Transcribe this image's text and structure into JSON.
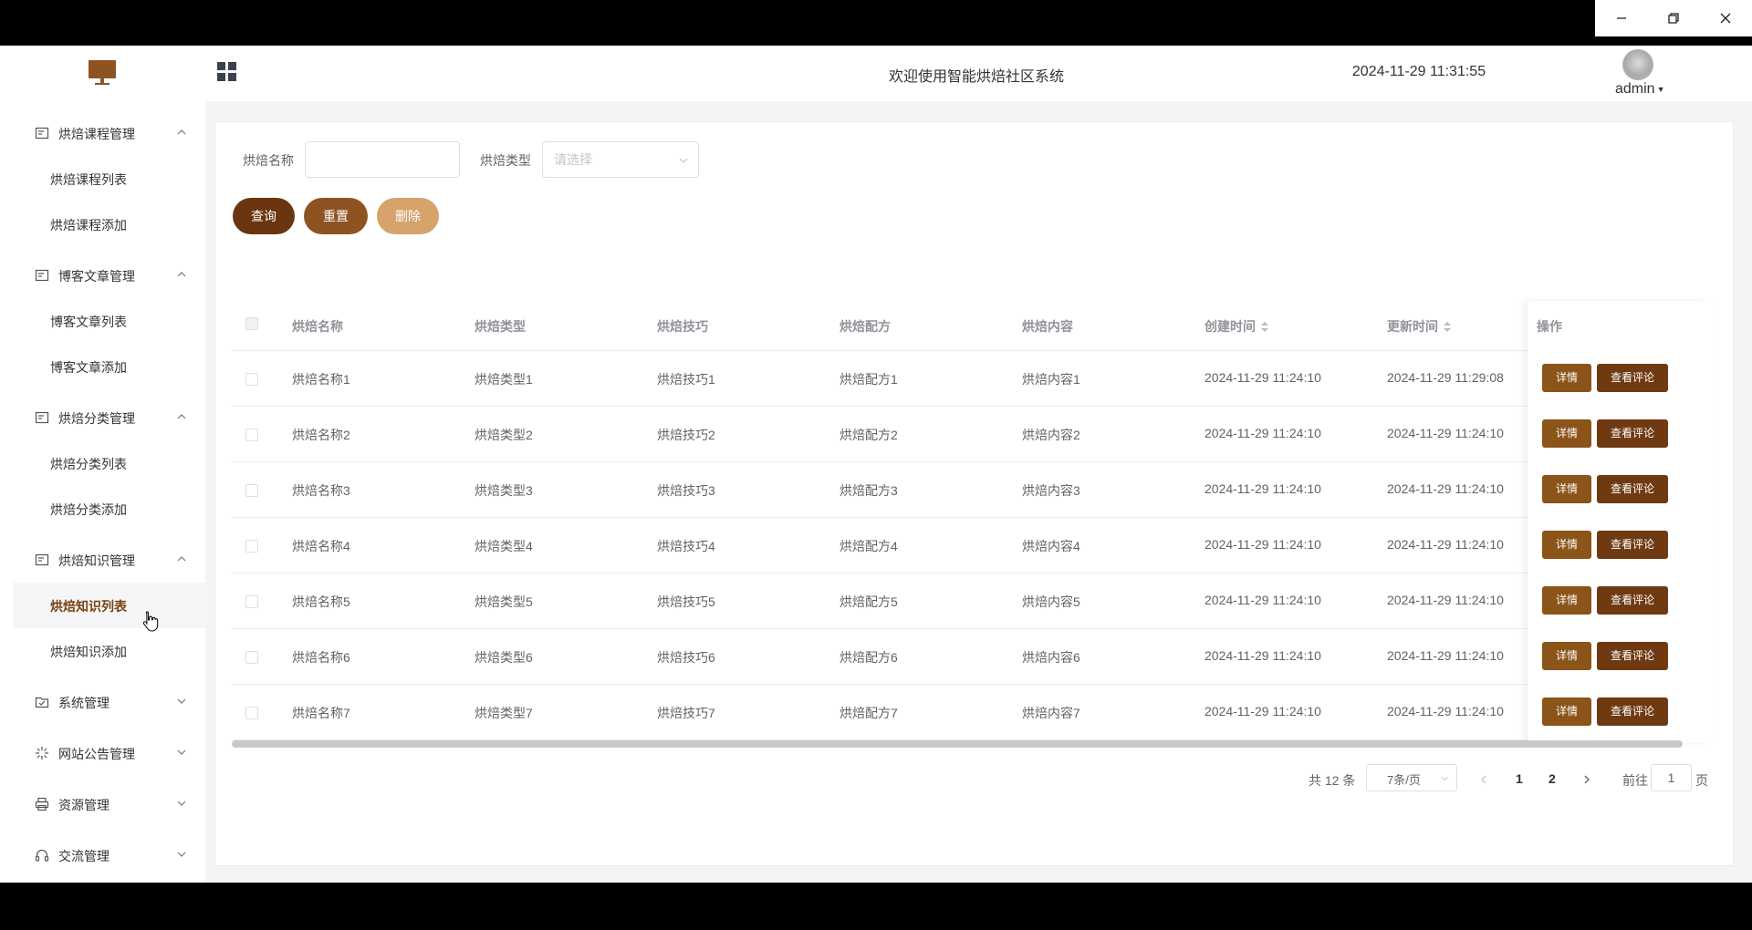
{
  "header": {
    "welcome": "欢迎使用智能烘焙社区系统",
    "datetime": "2024-11-29 11:31:55",
    "username": "admin"
  },
  "window": {
    "minimize": "minimize-icon",
    "restore": "restore-icon",
    "close": "close-icon"
  },
  "sidebar": {
    "groups": [
      {
        "label": "烘焙课程管理",
        "icon": "document-icon",
        "expanded": true,
        "items": [
          "烘焙课程列表",
          "烘焙课程添加"
        ]
      },
      {
        "label": "博客文章管理",
        "icon": "document-icon",
        "expanded": true,
        "items": [
          "博客文章列表",
          "博客文章添加"
        ]
      },
      {
        "label": "烘焙分类管理",
        "icon": "document-icon",
        "expanded": true,
        "items": [
          "烘焙分类列表",
          "烘焙分类添加"
        ]
      },
      {
        "label": "烘焙知识管理",
        "icon": "document-icon",
        "expanded": true,
        "items": [
          "烘焙知识列表",
          "烘焙知识添加"
        ]
      },
      {
        "label": "系统管理",
        "icon": "folder-icon",
        "expanded": false
      },
      {
        "label": "网站公告管理",
        "icon": "sparkle-icon",
        "expanded": false
      },
      {
        "label": "资源管理",
        "icon": "printer-icon",
        "expanded": false
      },
      {
        "label": "交流管理",
        "icon": "headphones-icon",
        "expanded": false
      }
    ],
    "active_item": "烘焙知识列表"
  },
  "filters": {
    "name_label": "烘焙名称",
    "name_value": "",
    "type_label": "烘焙类型",
    "type_placeholder": "请选择",
    "query_btn": "查询",
    "reset_btn": "重置",
    "delete_btn": "删除"
  },
  "table": {
    "columns": [
      "烘焙名称",
      "烘焙类型",
      "烘焙技巧",
      "烘焙配方",
      "烘焙内容",
      "创建时间",
      "更新时间",
      "操作"
    ],
    "rows": [
      {
        "name": "烘焙名称1",
        "type": "烘焙类型1",
        "skill": "烘焙技巧1",
        "recipe": "烘焙配方1",
        "content": "烘焙内容1",
        "created": "2024-11-29 11:24:10",
        "updated": "2024-11-29 11:29:08"
      },
      {
        "name": "烘焙名称2",
        "type": "烘焙类型2",
        "skill": "烘焙技巧2",
        "recipe": "烘焙配方2",
        "content": "烘焙内容2",
        "created": "2024-11-29 11:24:10",
        "updated": "2024-11-29 11:24:10"
      },
      {
        "name": "烘焙名称3",
        "type": "烘焙类型3",
        "skill": "烘焙技巧3",
        "recipe": "烘焙配方3",
        "content": "烘焙内容3",
        "created": "2024-11-29 11:24:10",
        "updated": "2024-11-29 11:24:10"
      },
      {
        "name": "烘焙名称4",
        "type": "烘焙类型4",
        "skill": "烘焙技巧4",
        "recipe": "烘焙配方4",
        "content": "烘焙内容4",
        "created": "2024-11-29 11:24:10",
        "updated": "2024-11-29 11:24:10"
      },
      {
        "name": "烘焙名称5",
        "type": "烘焙类型5",
        "skill": "烘焙技巧5",
        "recipe": "烘焙配方5",
        "content": "烘焙内容5",
        "created": "2024-11-29 11:24:10",
        "updated": "2024-11-29 11:24:10"
      },
      {
        "name": "烘焙名称6",
        "type": "烘焙类型6",
        "skill": "烘焙技巧6",
        "recipe": "烘焙配方6",
        "content": "烘焙内容6",
        "created": "2024-11-29 11:24:10",
        "updated": "2024-11-29 11:24:10"
      },
      {
        "name": "烘焙名称7",
        "type": "烘焙类型7",
        "skill": "烘焙技巧7",
        "recipe": "烘焙配方7",
        "content": "烘焙内容7",
        "created": "2024-11-29 11:24:10",
        "updated": "2024-11-29 11:24:10"
      }
    ],
    "detail_btn": "详情",
    "comments_btn": "查看评论"
  },
  "pagination": {
    "total": "共 12 条",
    "page_size": "7条/页",
    "pages": [
      "1",
      "2"
    ],
    "goto_label": "前往",
    "goto_value": "1",
    "page_suffix": "页"
  },
  "colors": {
    "brand_dark": "#6b3510",
    "brand_mid": "#8d5422",
    "brand_light": "#d6a36c",
    "op_detail": "#8b5418",
    "op_comments": "#6f3a12"
  }
}
